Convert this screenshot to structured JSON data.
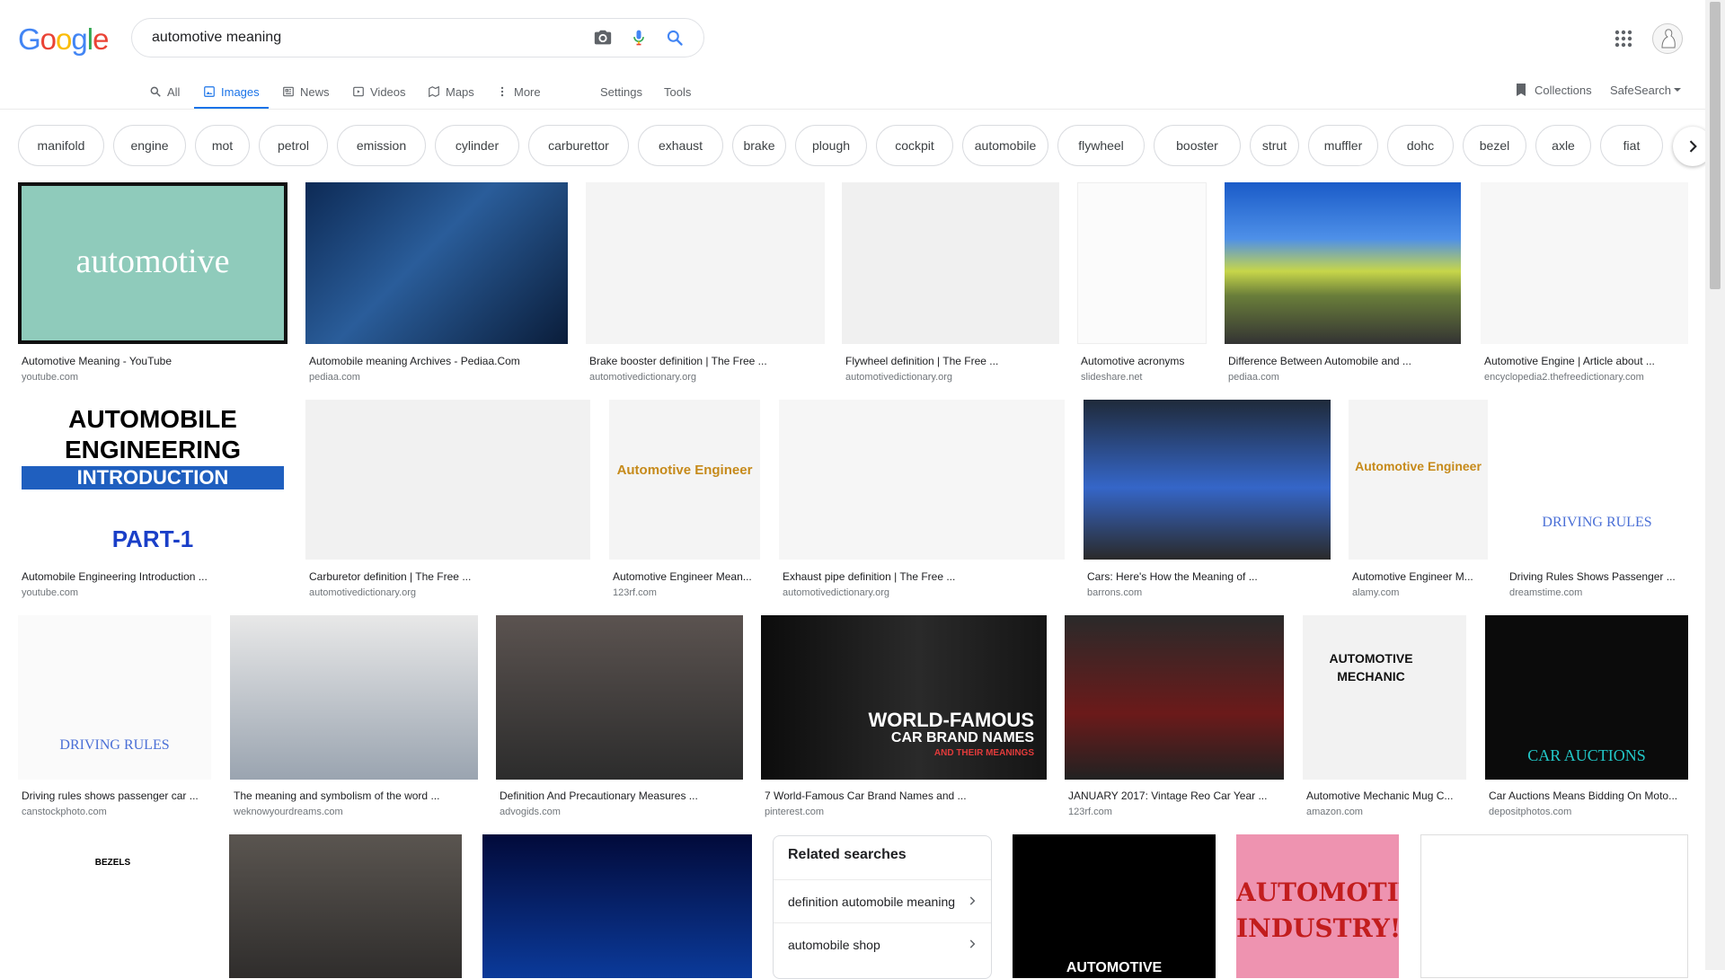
{
  "logo": {
    "letters": [
      "G",
      "o",
      "o",
      "g",
      "l",
      "e"
    ],
    "colors": [
      "#4285f4",
      "#ea4335",
      "#fbbc05",
      "#4285f4",
      "#34a853",
      "#ea4335"
    ]
  },
  "search": {
    "query": "automotive meaning",
    "icons": [
      "camera-icon",
      "mic-icon",
      "search-icon"
    ]
  },
  "tabs": [
    {
      "label": "All",
      "icon": "search-icon"
    },
    {
      "label": "Images",
      "icon": "image-icon",
      "active": true
    },
    {
      "label": "News",
      "icon": "news-icon"
    },
    {
      "label": "Videos",
      "icon": "video-icon"
    },
    {
      "label": "Maps",
      "icon": "map-icon"
    },
    {
      "label": "More",
      "icon": "dots-vertical-icon"
    }
  ],
  "tools": {
    "settings": "Settings",
    "tools": "Tools"
  },
  "right_links": {
    "collections": "Collections",
    "safesearch": "SafeSearch"
  },
  "chips": [
    "manifold",
    "engine",
    "mot",
    "petrol",
    "emission",
    "cylinder",
    "carburettor",
    "exhaust",
    "brake",
    "plough",
    "cockpit",
    "automobile",
    "flywheel",
    "booster",
    "strut",
    "muffler",
    "dohc",
    "bezel",
    "axle",
    "fiat"
  ],
  "results": {
    "row1": [
      {
        "caption": "Automotive Meaning - YouTube",
        "source": "youtube.com",
        "img_text": "automotive"
      },
      {
        "caption": "Automobile meaning Archives - Pediaa.Com",
        "source": "pediaa.com"
      },
      {
        "caption": "Brake booster definition | The Free ...",
        "source": "automotivedictionary.org"
      },
      {
        "caption": "Flywheel definition | The Free ...",
        "source": "automotivedictionary.org"
      },
      {
        "caption": "Automotive acronyms",
        "source": "slideshare.net"
      },
      {
        "caption": "Difference Between Automobile and ...",
        "source": "pediaa.com"
      },
      {
        "caption": "Automotive Engine | Article about ...",
        "source": "encyclopedia2.thefreedictionary.com"
      }
    ],
    "row2": [
      {
        "caption": "Automobile Engineering Introduction ...",
        "source": "youtube.com",
        "img_lines": [
          "AUTOMOBILE",
          "ENGINEERING",
          "INTRODUCTION",
          "PART-1"
        ]
      },
      {
        "caption": "Carburetor definition | The Free ...",
        "source": "automotivedictionary.org"
      },
      {
        "caption": "Automotive Engineer Mean...",
        "source": "123rf.com",
        "img_text": "Automotive Engineer"
      },
      {
        "caption": "Exhaust pipe definition | The Free ...",
        "source": "automotivedictionary.org"
      },
      {
        "caption": "Cars: Here's How the Meaning of ...",
        "source": "barrons.com"
      },
      {
        "caption": "Automotive Engineer M...",
        "source": "alamy.com",
        "img_text": "Automotive Engineer"
      },
      {
        "caption": "Driving Rules Shows Passenger ...",
        "source": "dreamstime.com",
        "img_text": "DRIVING RULES"
      }
    ],
    "row3": [
      {
        "caption": "Driving rules shows passenger car ...",
        "source": "canstockphoto.com",
        "img_text": "DRIVING RULES"
      },
      {
        "caption": "The meaning and symbolism of the word ...",
        "source": "weknowyourdreams.com"
      },
      {
        "caption": "Definition And Precautionary Measures ...",
        "source": "advogids.com"
      },
      {
        "caption": "7 World-Famous Car Brand Names and ...",
        "source": "pinterest.com",
        "img_lines": [
          "WORLD-FAMOUS",
          "CAR BRAND NAMES",
          "AND THEIR MEANINGS"
        ]
      },
      {
        "caption": "JANUARY 2017: Vintage Reo Car Year ...",
        "source": "123rf.com"
      },
      {
        "caption": "Automotive Mechanic Mug C...",
        "source": "amazon.com",
        "img_lines": [
          "AUTOMOTIVE",
          "MECHANIC"
        ]
      },
      {
        "caption": "Car Auctions Means Bidding On Moto...",
        "source": "depositphotos.com",
        "img_text": "CAR AUCTIONS"
      }
    ],
    "row4": [
      {
        "img_text": "BEZELS"
      },
      {},
      {},
      {
        "img_text": "AUTOMOTIVE"
      },
      {
        "img_lines": [
          "AUTOMOTIVE",
          "INDUSTRY!"
        ]
      },
      {}
    ]
  },
  "related": {
    "title": "Related searches",
    "items": [
      "definition automobile meaning",
      "automobile shop"
    ]
  }
}
